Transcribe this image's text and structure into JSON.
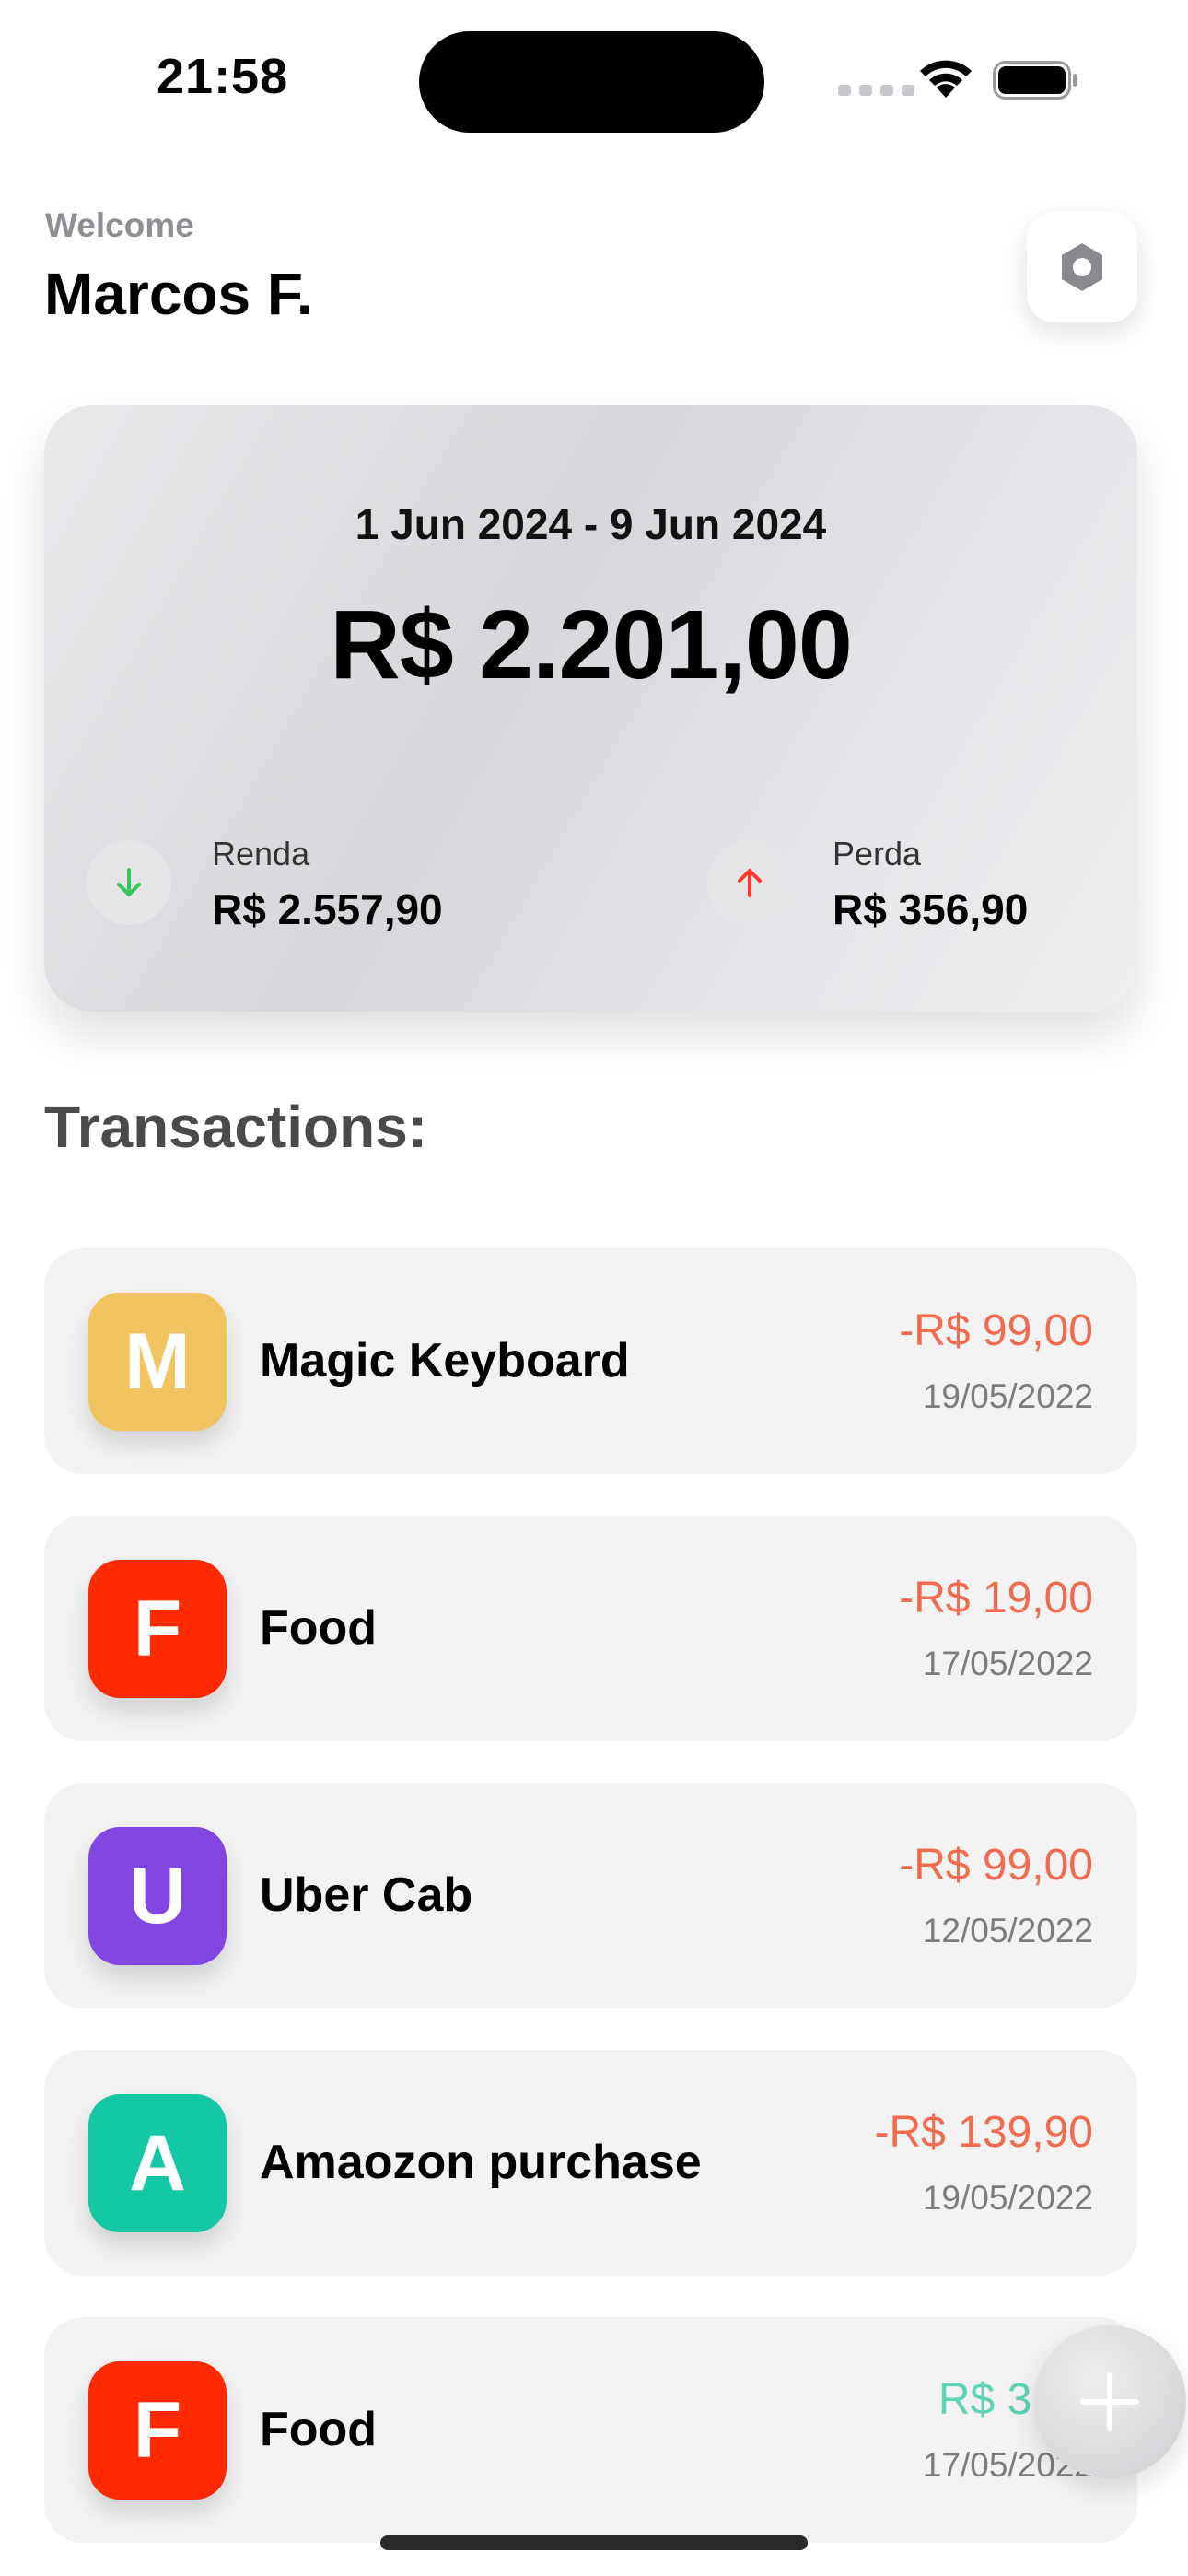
{
  "status_bar": {
    "time": "21:58"
  },
  "header": {
    "welcome": "Welcome",
    "user_name": "Marcos F."
  },
  "balance_card": {
    "date_range": "1 Jun 2024 - 9 Jun 2024",
    "total": "R$ 2.201,00",
    "income": {
      "label": "Renda",
      "value": "R$ 2.557,90",
      "color": "#34c759"
    },
    "expense": {
      "label": "Perda",
      "value": "R$ 356,90",
      "color": "#ff3b30"
    }
  },
  "transactions": {
    "title": "Transactions:",
    "items": [
      {
        "initial": "M",
        "name": "Magic Keyboard",
        "amount": "-R$ 99,00",
        "date": "19/05/2022",
        "avatar_color": "#f2c45f",
        "amount_color": "#f26b4f"
      },
      {
        "initial": "F",
        "name": "Food",
        "amount": "-R$ 19,00",
        "date": "17/05/2022",
        "avatar_color": "#ff2a00",
        "amount_color": "#f26b4f"
      },
      {
        "initial": "U",
        "name": "Uber Cab",
        "amount": "-R$ 99,00",
        "date": "12/05/2022",
        "avatar_color": "#8145e0",
        "amount_color": "#f26b4f"
      },
      {
        "initial": "A",
        "name": "Amaozon purchase",
        "amount": "-R$ 139,90",
        "date": "19/05/2022",
        "avatar_color": "#14c8a6",
        "amount_color": "#f26b4f"
      },
      {
        "initial": "F",
        "name": "Food",
        "amount": "R$ 319,",
        "date": "17/05/2022",
        "avatar_color": "#ff2a00",
        "amount_color": "#5fd3b5"
      }
    ]
  },
  "icons": {
    "settings": "gear-icon",
    "income": "arrow-down-icon",
    "expense": "arrow-up-icon",
    "add": "plus-icon"
  }
}
